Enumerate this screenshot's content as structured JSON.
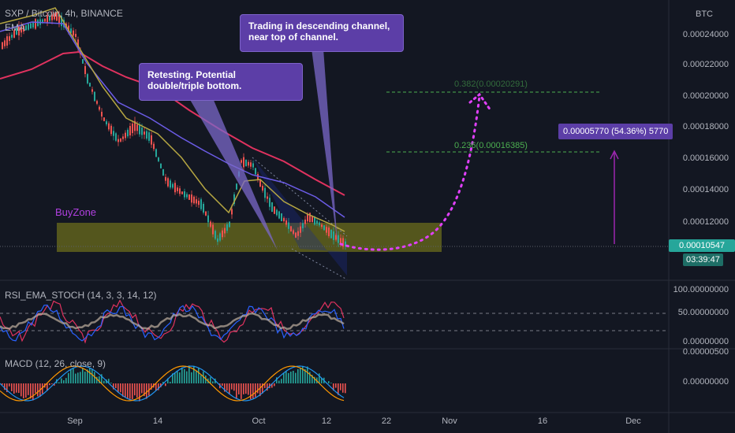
{
  "header": {
    "symbol": "SXP / Bitcoin, 4h, BINANCE",
    "indicator": "EMA",
    "currency": "BTC"
  },
  "price_axis": {
    "labels": [
      "0.00024000",
      "0.00022000",
      "0.00020000",
      "0.00018000",
      "0.00016000",
      "0.00014000",
      "0.00012000"
    ],
    "current_price": "0.00010547",
    "countdown": "03:39:47"
  },
  "annotations": {
    "callout_left": "Retesting. Potential double/triple bottom.",
    "callout_right": "Trading in descending channel, near top of channel.",
    "buyzone": "BuyZone",
    "fib_382": "0.382(0.00020291)",
    "fib_236": "0.236(0.00016385)",
    "measure": "0.00005770 (54.36%) 5770"
  },
  "rsi": {
    "title": "RSI_EMA_STOCH (14, 3, 3, 14, 12)",
    "labels": [
      "100.00000000",
      "50.00000000",
      "0.00000000"
    ]
  },
  "macd": {
    "title": "MACD (12, 26, close, 9)",
    "labels": [
      "0.00000500",
      "0.00000000"
    ]
  },
  "time_axis": {
    "labels": [
      "Sep",
      "14",
      "Oct",
      "12",
      "22",
      "Nov",
      "16",
      "Dec"
    ]
  },
  "colors": {
    "background": "#131722",
    "buyzone": "#8a8a1a",
    "callout": "#5c3ea7",
    "ema_fast": "#b5a642",
    "ema_mid": "#6c5ce7",
    "ema_slow": "#e0325f",
    "fib": "#4caf50",
    "projection": "#e040fb",
    "price_tag": "#26a69a"
  }
}
